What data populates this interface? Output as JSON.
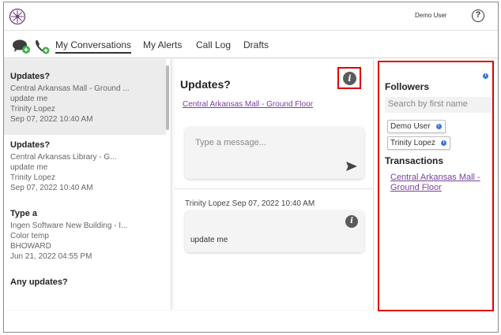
{
  "header": {
    "user_name": "Demo User",
    "help_glyph": "?"
  },
  "nav": {
    "tabs": [
      {
        "label": "My Conversations",
        "active": true
      },
      {
        "label": "My Alerts",
        "active": false
      },
      {
        "label": "Call Log",
        "active": false
      },
      {
        "label": "Drafts",
        "active": false
      }
    ]
  },
  "conversations": [
    {
      "title": "Updates?",
      "location": "Central Arkansas Mall - Ground ...",
      "preview": "update me",
      "author": "Trinity Lopez",
      "date": "Sep 07, 2022 10:40 AM",
      "selected": true
    },
    {
      "title": "Updates?",
      "location": "Central Arkansas  Library - G...",
      "preview": "update me",
      "author": "Trinity Lopez",
      "date": "Sep 07, 2022 10:40 AM",
      "selected": false
    },
    {
      "title": "Type a",
      "location": "Ingen Software New Building - I...",
      "preview": "Color temp",
      "author": "BHOWARD",
      "date": "Jun 21, 2022 04:55 PM",
      "selected": false
    },
    {
      "title": "Any updates?",
      "location": "",
      "preview": "",
      "author": "",
      "date": "",
      "selected": false
    }
  ],
  "detail": {
    "title": "Updates?",
    "link": "Central Arkansas Mall - Ground Floor",
    "compose_placeholder": "Type a message...",
    "message": {
      "author": "Trinity Lopez",
      "date": "Sep 07, 2022 10:40 AM",
      "text": "update me"
    }
  },
  "sidebar": {
    "followers_title": "Followers",
    "search_placeholder": "Search by first name",
    "followers": [
      "Demo User",
      "Trinity Lopez"
    ],
    "transactions_title": "Transactions",
    "transaction_link": "Central Arkansas Mall - Ground Floor"
  },
  "colors": {
    "accent_link": "#7a3fa0",
    "highlight_box": "#e00000",
    "badge_blue": "#3a78d8"
  },
  "icons": {
    "logo": "compass-logo-icon",
    "chat": "chat-icon",
    "phone": "phone-icon",
    "info": "info-icon",
    "send": "send-icon"
  }
}
